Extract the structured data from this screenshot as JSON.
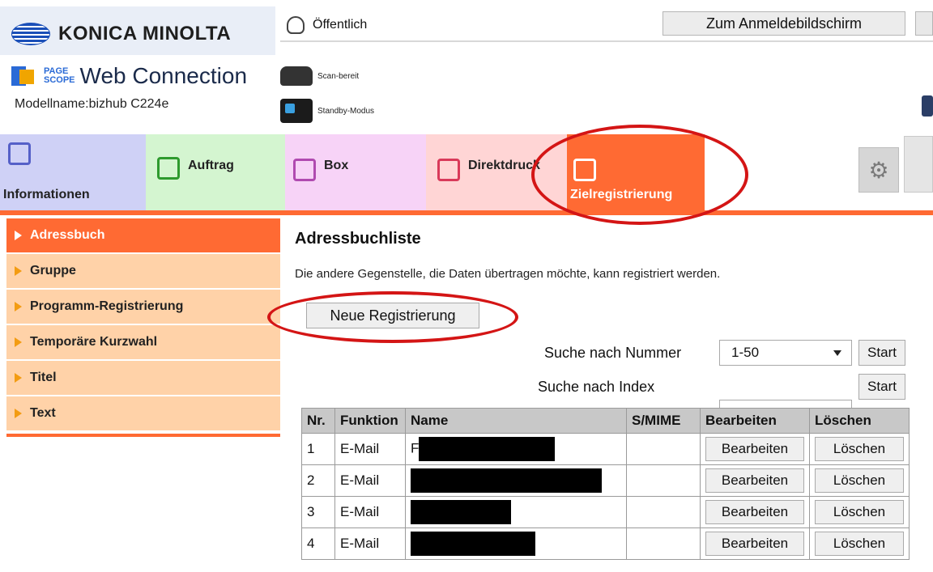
{
  "header": {
    "brand": "KONICA MINOLTA",
    "pagescope_line1": "PAGE",
    "pagescope_line2": "SCOPE",
    "product": "Web Connection",
    "model": "Modellname:bizhub C224e",
    "user_mode": "Öffentlich",
    "login_button": "Zum Anmeldebildschirm",
    "status_scan": "Scan-bereit",
    "status_standby": "Standby-Modus"
  },
  "tabs": [
    {
      "label": "Informationen",
      "icon": "info-icon"
    },
    {
      "label": "Auftrag",
      "icon": "document-icon"
    },
    {
      "label": "Box",
      "icon": "box-icon"
    },
    {
      "label": "Direktdruck",
      "icon": "print-icon"
    },
    {
      "label": "Zielregistrierung",
      "icon": "destination-icon"
    }
  ],
  "sidebar": {
    "items": [
      {
        "label": "Adressbuch",
        "active": true
      },
      {
        "label": "Gruppe"
      },
      {
        "label": "Programm-Registrierung"
      },
      {
        "label": "Temporäre Kurzwahl"
      },
      {
        "label": "Titel"
      },
      {
        "label": "Text"
      }
    ]
  },
  "main": {
    "title": "Adressbuchliste",
    "description": "Die andere Gegenstelle, die Daten übertragen möchte, kann registriert werden.",
    "new_button": "Neue Registrierung",
    "search_number_label": "Suche nach Nummer",
    "search_number_value": "1-50",
    "search_index_label": "Suche nach Index",
    "search_index_value": "",
    "start_label": "Start"
  },
  "table": {
    "headers": [
      "Nr.",
      "Funktion",
      "Name",
      "S/MIME",
      "Bearbeiten",
      "Löschen"
    ],
    "rows": [
      {
        "nr": "1",
        "funktion": "E-Mail",
        "name_prefix": "F",
        "smime": "",
        "edit": "Bearbeiten",
        "delete": "Löschen"
      },
      {
        "nr": "2",
        "funktion": "E-Mail",
        "name_prefix": "",
        "smime": "",
        "edit": "Bearbeiten",
        "delete": "Löschen"
      },
      {
        "nr": "3",
        "funktion": "E-Mail",
        "name_prefix": "",
        "smime": "",
        "edit": "Bearbeiten",
        "delete": "Löschen"
      },
      {
        "nr": "4",
        "funktion": "E-Mail",
        "name_prefix": "",
        "smime": "",
        "edit": "Bearbeiten",
        "delete": "Löschen"
      }
    ]
  },
  "colors": {
    "accent": "#ff6a33",
    "sidebar_bg": "#ffd2a8",
    "annotation": "#d41515"
  }
}
